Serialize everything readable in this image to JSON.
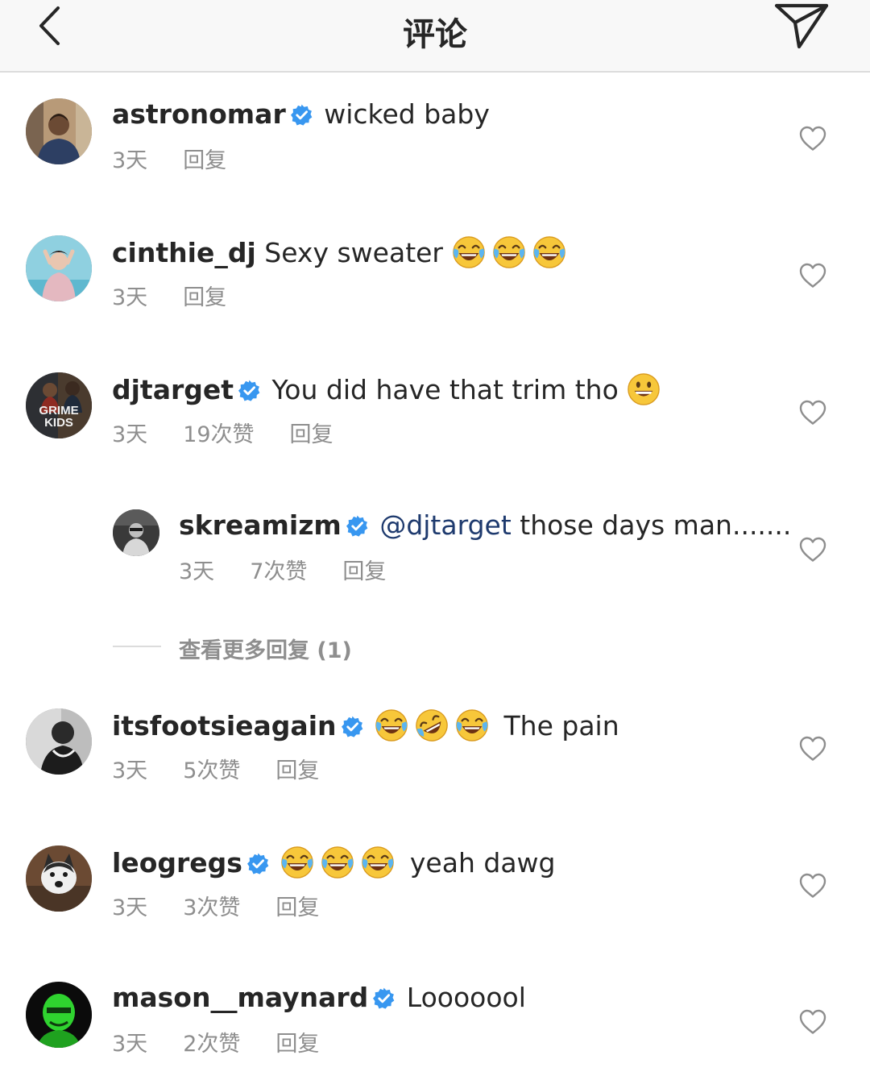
{
  "header": {
    "title": "评论",
    "back_icon": "chevron-left-icon",
    "send_icon": "paper-plane-icon"
  },
  "comments": [
    {
      "username": "astronomar",
      "verified": true,
      "text": "wicked baby",
      "time": "3天",
      "likes": "",
      "reply": "回复"
    },
    {
      "username": "cinthie_dj",
      "verified": false,
      "text": "Sexy sweater",
      "emojis": [
        "face-with-tears-of-joy",
        "face-with-tears-of-joy",
        "face-with-tears-of-joy"
      ],
      "time": "3天",
      "likes": "",
      "reply": "回复"
    },
    {
      "username": "djtarget",
      "verified": true,
      "text": "You did have that trim tho",
      "emojis": [
        "grinning-face"
      ],
      "avatar_text": "GRIME KIDS",
      "time": "3天",
      "likes": "19次赞",
      "reply": "回复"
    },
    {
      "username": "skreamizm",
      "verified": true,
      "mention": "@djtarget",
      "text": "those days man.......",
      "time": "3天",
      "likes": "7次赞",
      "reply": "回复"
    },
    {
      "username": "itsfootsieagain",
      "verified": true,
      "text": "The pain",
      "emojis": [
        "face-with-tears-of-joy",
        "rolling-on-floor-laughing",
        "face-with-tears-of-joy"
      ],
      "time": "3天",
      "likes": "5次赞",
      "reply": "回复"
    },
    {
      "username": "leogregs",
      "verified": true,
      "text": "yeah dawg",
      "emojis": [
        "face-with-tears-of-joy",
        "face-with-tears-of-joy",
        "face-with-tears-of-joy"
      ],
      "time": "3天",
      "likes": "3次赞",
      "reply": "回复"
    },
    {
      "username": "mason__maynard",
      "verified": true,
      "text": "Looooool",
      "time": "3天",
      "likes": "2次赞",
      "reply": "回复"
    }
  ],
  "view_more_replies": "查看更多回复 (1)",
  "colors": {
    "verified_badge": "#3897f0",
    "meta_text": "#8e8e8e",
    "mention": "#1e3a6e",
    "header_bg": "#f8f8f8"
  }
}
